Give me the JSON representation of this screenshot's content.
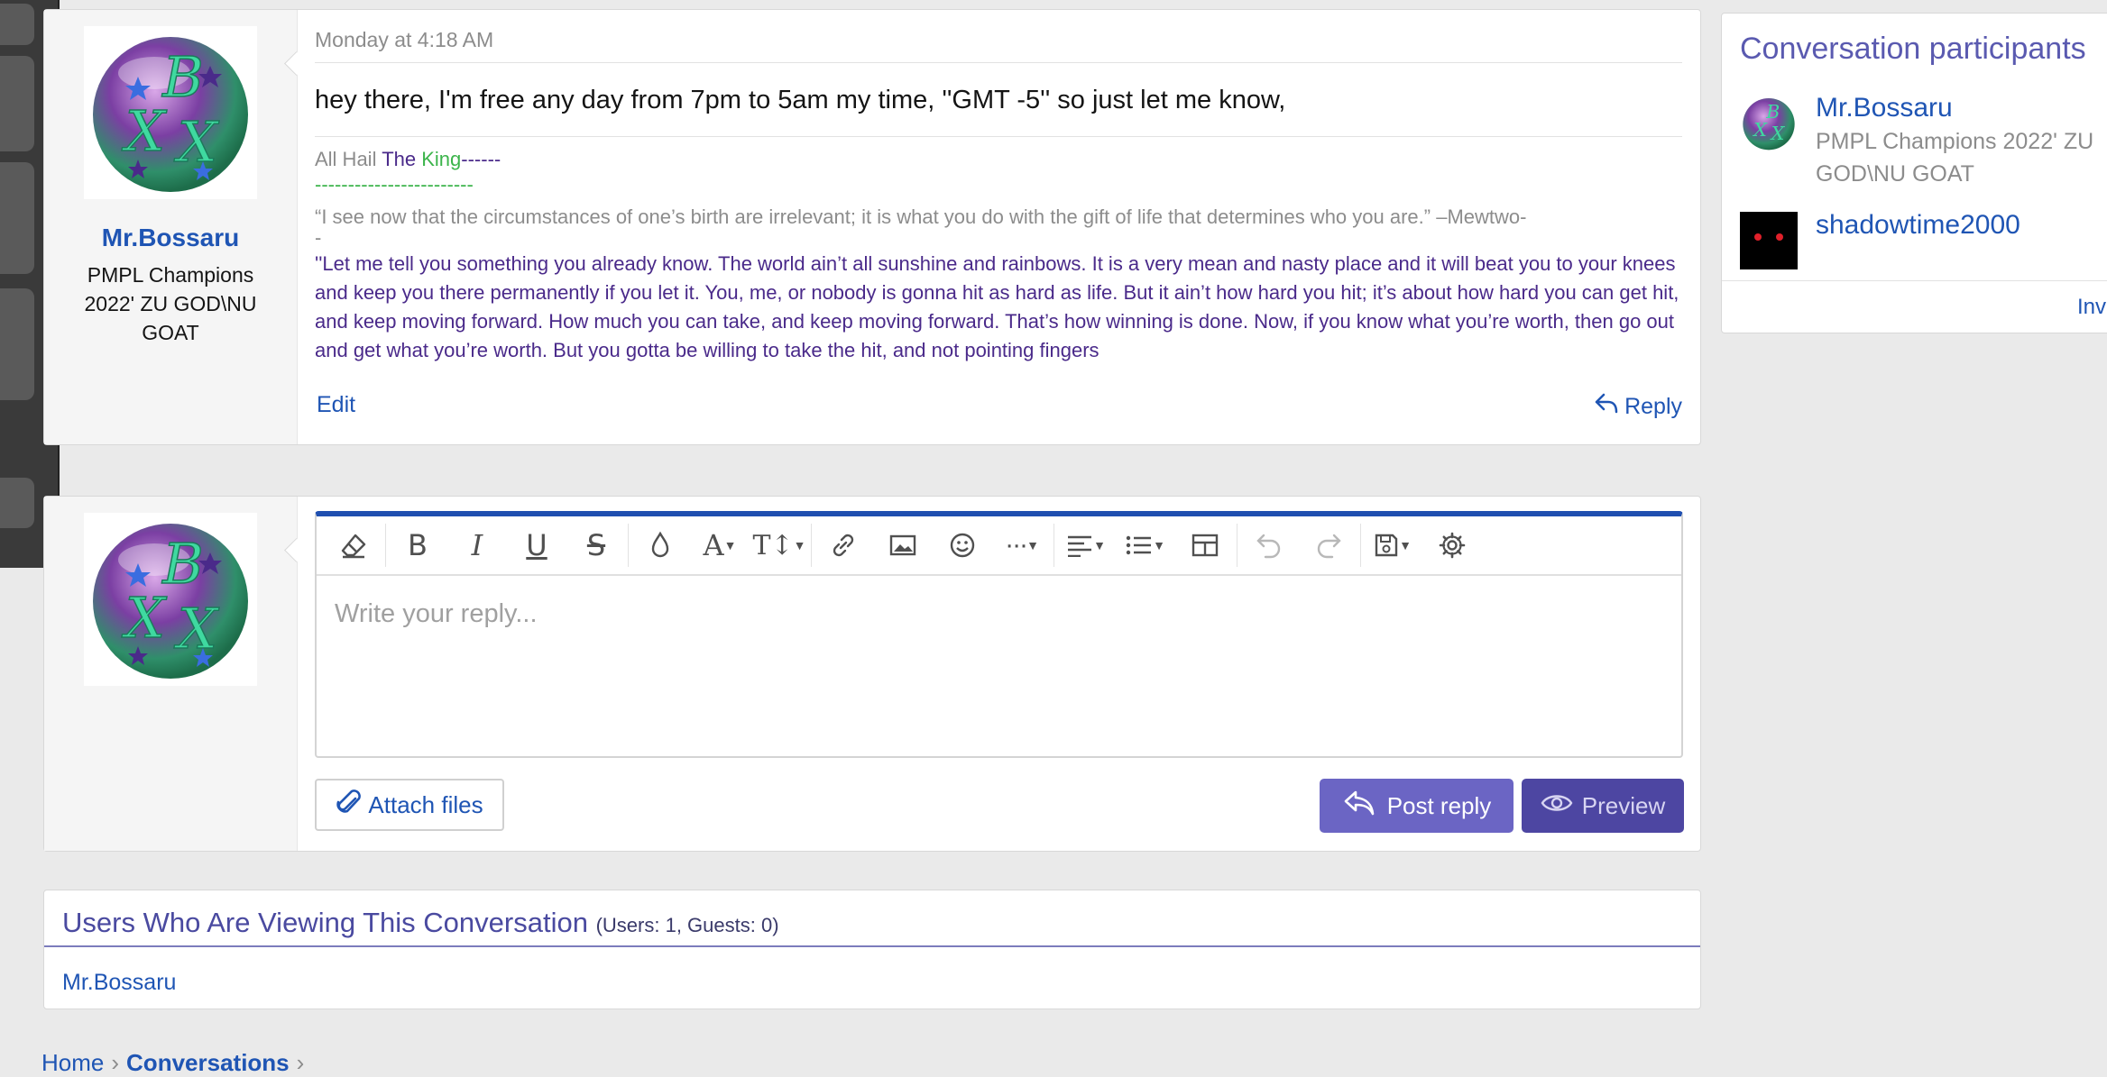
{
  "message": {
    "date": "Monday at 4:18 AM",
    "body": "hey there, I'm free any day from 7pm to 5am my time, ''GMT -5'' so just let me know,",
    "author": {
      "username": "Mr.Bossaru",
      "title": "PMPL Champions 2022' ZU GOD\\NU GOAT",
      "avatar_letters": "BXX"
    },
    "signature": {
      "line1_a": "All Hail ",
      "line1_b": "The ",
      "line1_c": "King",
      "line1_d": "------",
      "line2": "------------------------",
      "quote1": "“I see now that the circumstances of one’s birth are irrelevant; it is what you do with the gift of life that determines who you are.” –Mewtwo-",
      "quote1_end": "-",
      "quote2": "''Let me tell you something you already know. The world ain’t all sunshine and rainbows. It is a very mean and nasty place and it will beat you to your knees and keep you there permanently if you let it. You, me, or nobody is gonna hit as hard as life. But it ain’t how hard you hit; it’s about how hard you can get hit, and keep moving forward. How much you can take, and keep moving forward. That’s how winning is done. Now, if you know what you’re worth, then go out and get what you’re worth. But you gotta be willing to take the hit, and not pointing fingers"
    },
    "edit_label": "Edit",
    "reply_label": "Reply"
  },
  "reply_form": {
    "placeholder": "Write your reply...",
    "attach_label": "Attach files",
    "post_label": "Post reply",
    "preview_label": "Preview",
    "toolbar": [
      "eraser-icon",
      "bold-icon",
      "italic-icon",
      "underline-icon",
      "strikethrough-icon",
      "text-color-icon",
      "font-family-icon",
      "font-size-icon",
      "link-icon",
      "image-icon",
      "emoji-icon",
      "more-icon",
      "align-icon",
      "list-icon",
      "table-icon",
      "undo-icon",
      "redo-icon",
      "drafts-icon",
      "settings-icon"
    ]
  },
  "viewing": {
    "title": "Users Who Are Viewing This Conversation",
    "count": "(Users: 1, Guests: 0)",
    "users": [
      "Mr.Bossaru"
    ]
  },
  "sidebar": {
    "title": "Conversation participants",
    "participants": [
      {
        "name": "Mr.Bossaru",
        "title_line1": "PMPL Champions 2022' ZU",
        "title_line2": "GOD\\NU GOAT"
      },
      {
        "name": "shadowtime2000"
      }
    ],
    "invite_label": "Invite m"
  },
  "breadcrumb": {
    "home": "Home",
    "conversations": "Conversations"
  },
  "colors": {
    "link": "#1f55b4",
    "editor_accent": "#1f4fb0",
    "post_button": "#6b65c4",
    "preview_button": "#4d46a2",
    "sidebar_title": "#5a5ab0"
  }
}
